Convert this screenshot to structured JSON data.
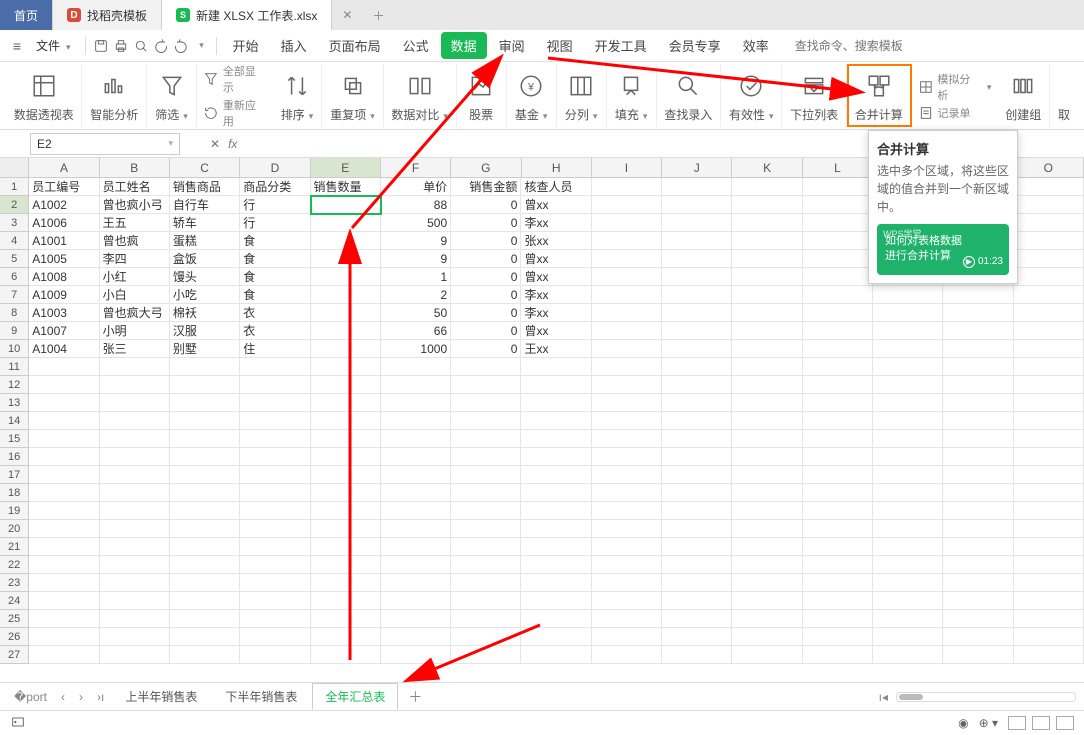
{
  "tabs": {
    "home": "首页",
    "template": "找稻壳模板",
    "doc": "新建 XLSX 工作表.xlsx"
  },
  "file_menu": "文件",
  "menus": [
    "开始",
    "插入",
    "页面布局",
    "公式",
    "数据",
    "审阅",
    "视图",
    "开发工具",
    "会员专享",
    "效率"
  ],
  "menu_active_index": 4,
  "search_placeholder": "查找命令、搜索模板",
  "ribbon": {
    "pivot": "数据透视表",
    "smart": "智能分析",
    "filter": "筛选",
    "showall": "全部显示",
    "reapply": "重新应用",
    "sort": "排序",
    "dup": "重复项",
    "compare": "数据对比",
    "stock": "股票",
    "fund": "基金",
    "split": "分列",
    "fill": "填充",
    "find_input": "查找录入",
    "validity": "有效性",
    "dropdown": "下拉列表",
    "consolidate": "合并计算",
    "whatif": "模拟分析",
    "record": "记录单",
    "group_create": "创建组",
    "group_cancel": "取"
  },
  "namebox": "E2",
  "headers": [
    "A",
    "B",
    "C",
    "D",
    "E",
    "F",
    "G",
    "H",
    "I",
    "J",
    "K",
    "L",
    "M",
    "N",
    "O"
  ],
  "row_count": 27,
  "active": {
    "row": 2,
    "col": 5
  },
  "table": {
    "cols": [
      "员工编号",
      "员工姓名",
      "销售商品",
      "商品分类",
      "销售数量",
      "单价",
      "销售金额",
      "核查人员"
    ],
    "rows": [
      [
        "A1002",
        "曾也疯小弓",
        "自行车",
        "行",
        "",
        "88",
        "0",
        "曾xx"
      ],
      [
        "A1006",
        "王五",
        "轿车",
        "行",
        "",
        "500",
        "0",
        "李xx"
      ],
      [
        "A1001",
        "曾也疯",
        "蛋糕",
        "食",
        "",
        "9",
        "0",
        "张xx"
      ],
      [
        "A1005",
        "李四",
        "盒饭",
        "食",
        "",
        "9",
        "0",
        "曾xx"
      ],
      [
        "A1008",
        "小红",
        "馒头",
        "食",
        "",
        "1",
        "0",
        "曾xx"
      ],
      [
        "A1009",
        "小白",
        "小吃",
        "食",
        "",
        "2",
        "0",
        "李xx"
      ],
      [
        "A1003",
        "曾也疯大弓",
        "棉袄",
        "衣",
        "",
        "50",
        "0",
        "李xx"
      ],
      [
        "A1007",
        "小明",
        "汉服",
        "衣",
        "",
        "66",
        "0",
        "曾xx"
      ],
      [
        "A1004",
        "张三",
        "别墅",
        "住",
        "",
        "1000",
        "0",
        "王xx"
      ]
    ]
  },
  "sheets": [
    "上半年销售表",
    "下半年销售表",
    "全年汇总表"
  ],
  "sheet_active_index": 2,
  "tooltip": {
    "title": "合并计算",
    "desc": "选中多个区域，将这些区域的值合并到一个新区域中。",
    "video_tag": "WPS学堂",
    "video_title": "如何对表格数据\n进行合并计算",
    "video_time": "01:23"
  }
}
